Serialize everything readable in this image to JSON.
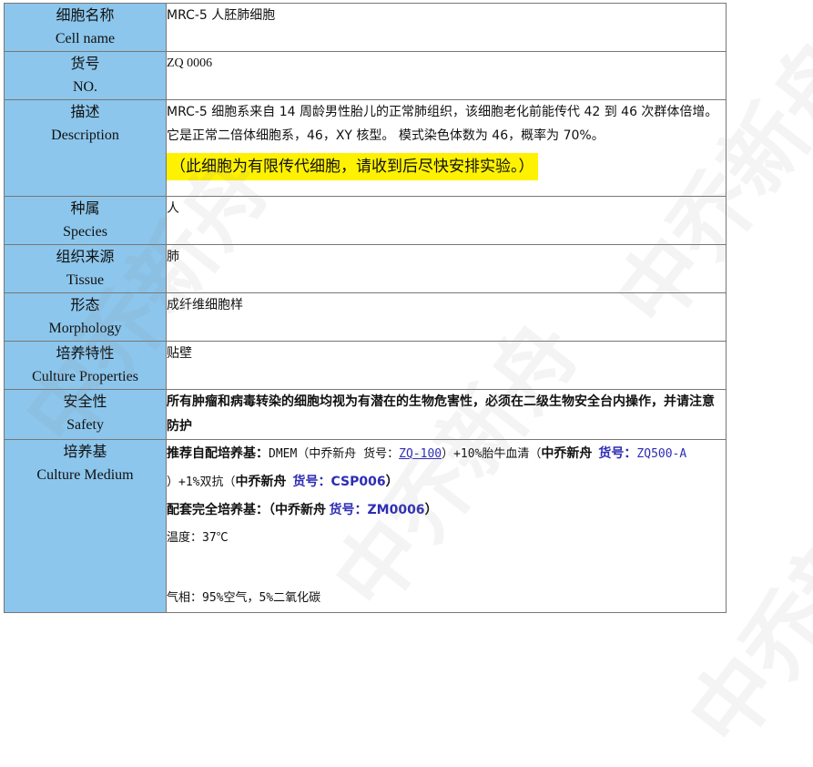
{
  "rows": {
    "name": {
      "cn": "细胞名称",
      "en": "Cell name",
      "value": "MRC-5 人胚肺细胞"
    },
    "no": {
      "cn": "货号",
      "en": "NO.",
      "value": "ZQ 0006"
    },
    "desc": {
      "cn": "描述",
      "en": "Description",
      "value": "MRC-5 细胞系来自 14 周龄男性胎儿的正常肺组织，该细胞老化前能传代 42 到 46 次群体倍增。 它是正常二倍体细胞系，46，XY 核型。 模式染色体数为 46，概率为 70%。",
      "note": "（此细胞为有限传代细胞，请收到后尽快安排实验。）"
    },
    "species": {
      "cn": "种属",
      "en": "Species",
      "value": "人"
    },
    "tissue": {
      "cn": "组织来源",
      "en": "Tissue",
      "value": "肺"
    },
    "morph": {
      "cn": "形态",
      "en": "Morphology",
      "value": "成纤维细胞样"
    },
    "culture": {
      "cn": "培养特性",
      "en": "Culture Properties",
      "value": "贴壁"
    },
    "safety": {
      "cn": "安全性",
      "en": "Safety",
      "value": "所有肿瘤和病毒转染的细胞均视为有潜在的生物危害性，必须在二级生物安全台内操作，并请注意防护"
    },
    "medium": {
      "cn": "培养基",
      "en": "Culture Medium",
      "line1_a": "推荐自配培养基：",
      "line1_b": "DMEM（中乔新舟 货号：",
      "line1_link": "ZQ-100",
      "line1_c": "）+10%胎牛血清（",
      "line1_d": "中乔新舟",
      "line1_e": "货号：",
      "line1_f": "ZQ500-A",
      "line2_a": "）+1%双抗（",
      "line2_b": "中乔新舟",
      "line2_c": "货号：CSP006",
      "line2_d": "）",
      "line3_a": "配套完全培养基：（中乔新舟",
      "line3_b": "货号：ZM0006",
      "line3_c": "）",
      "line4": "温度：37℃",
      "line5": "气相：95%空气，5%二氧化碳"
    }
  },
  "watermark": "中乔新舟"
}
